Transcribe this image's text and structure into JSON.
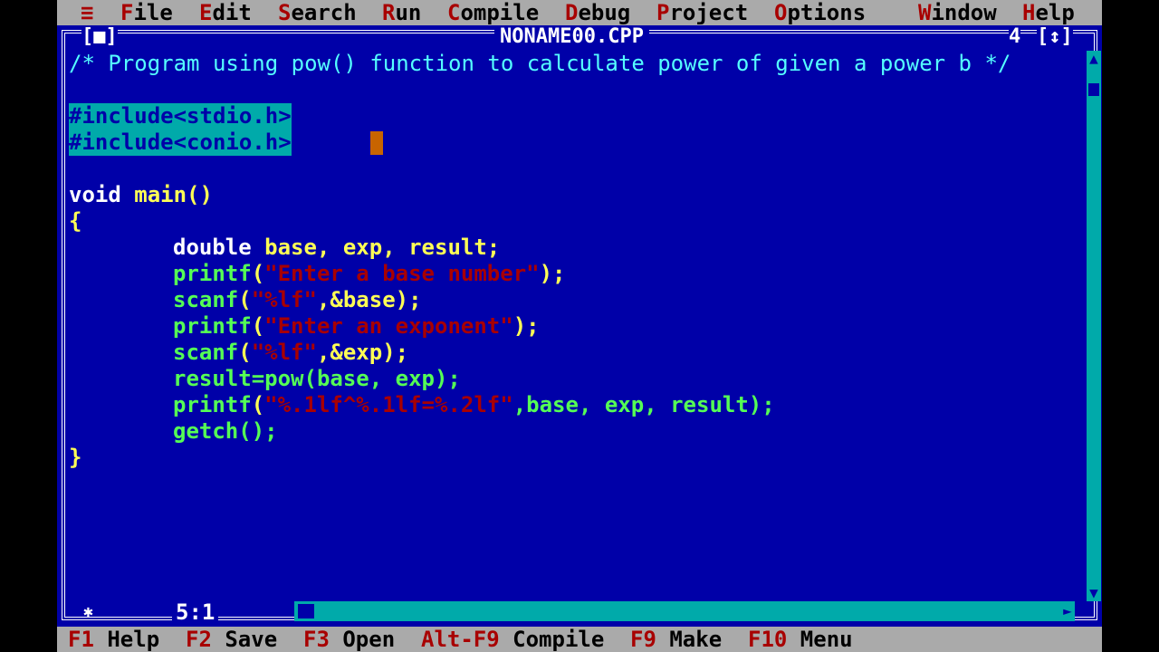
{
  "menu": {
    "system": "≡",
    "items": [
      {
        "hot": "F",
        "rest": "ile"
      },
      {
        "hot": "E",
        "rest": "dit"
      },
      {
        "hot": "S",
        "rest": "earch"
      },
      {
        "hot": "R",
        "rest": "un"
      },
      {
        "hot": "C",
        "rest": "ompile"
      },
      {
        "hot": "D",
        "rest": "ebug"
      },
      {
        "hot": "P",
        "rest": "roject"
      },
      {
        "hot": "O",
        "rest": "ptions"
      },
      {
        "hot": "W",
        "rest": "indow"
      },
      {
        "hot": "H",
        "rest": "elp"
      }
    ]
  },
  "window": {
    "title": "NONAME00.CPP",
    "close_box": "[■]",
    "number": "4",
    "zoom_box": "[↕]"
  },
  "code": {
    "comment": "/* Program using pow() function to calculate power of given a power b */",
    "include1": "#include<stdio.h>",
    "include2": "#include<conio.h>",
    "main_kw": "void",
    "main_fn": "main()",
    "open_brace": "{",
    "close_brace": "}",
    "l_decl_kw": "double",
    "l_decl_ids": "base, exp, result;",
    "printf": "printf",
    "scanf": "scanf",
    "str_base": "\"Enter a base number\"",
    "str_exp": "\"Enter an exponent\"",
    "fmt_lf": "\"%lf\"",
    "arg_base": ",&base);",
    "arg_exp": ",&exp);",
    "result_line": "result=pow(base, exp);",
    "fmt_out": "\"%.1lf^%.1lf=%.2lf\"",
    "args_out": ",base, exp, result);",
    "getch": "getch();",
    "open_paren": "(",
    "close_semicolon": ");"
  },
  "cursor_pos": "5:1",
  "status": [
    {
      "key": "F1",
      "label": " Help"
    },
    {
      "key": "F2",
      "label": " Save"
    },
    {
      "key": "F3",
      "label": " Open"
    },
    {
      "key": "Alt-F9",
      "label": " Compile"
    },
    {
      "key": "F9",
      "label": " Make"
    },
    {
      "key": "F10",
      "label": " Menu"
    }
  ]
}
